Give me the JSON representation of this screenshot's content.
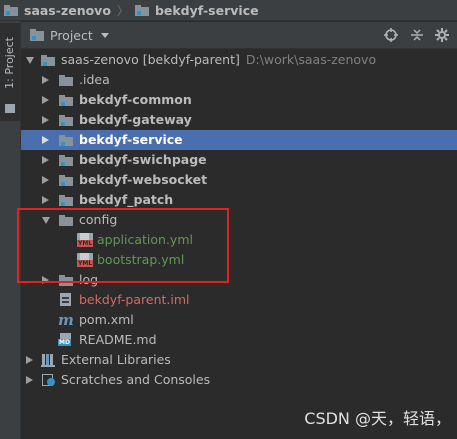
{
  "breadcrumb": {
    "items": [
      "saas-zenovo",
      "bekdyf-service"
    ],
    "separator": "〉"
  },
  "side_tab": {
    "label": "1: Project"
  },
  "panel": {
    "title": "Project",
    "buttons": [
      "target-icon",
      "collapse-icon",
      "settings-icon",
      "hide-icon"
    ]
  },
  "tree": {
    "root": {
      "name": "saas-zenovo [bekdyf-parent]",
      "path": "D:\\work\\saas-zenovo"
    },
    "items": [
      {
        "label": ".idea"
      },
      {
        "label": "bekdyf-common"
      },
      {
        "label": "bekdyf-gateway"
      },
      {
        "label": "bekdyf-service",
        "selected": true
      },
      {
        "label": "bekdyf-swichpage"
      },
      {
        "label": "bekdyf-websocket"
      },
      {
        "label": "bekdyf_patch"
      },
      {
        "label": "config"
      },
      {
        "label": "application.yml"
      },
      {
        "label": "bootstrap.yml"
      },
      {
        "label": "log"
      },
      {
        "label": "bekdyf-parent.iml"
      },
      {
        "label": "pom.xml"
      },
      {
        "label": "README.md"
      },
      {
        "label": "External Libraries"
      },
      {
        "label": "Scratches and Consoles"
      }
    ]
  },
  "watermark": "CSDN @天，轻语，",
  "colors": {
    "selection": "#4b6eaf",
    "highlight_box": "#e02222",
    "yml_text": "#629755",
    "iml_text": "#d36a63"
  }
}
